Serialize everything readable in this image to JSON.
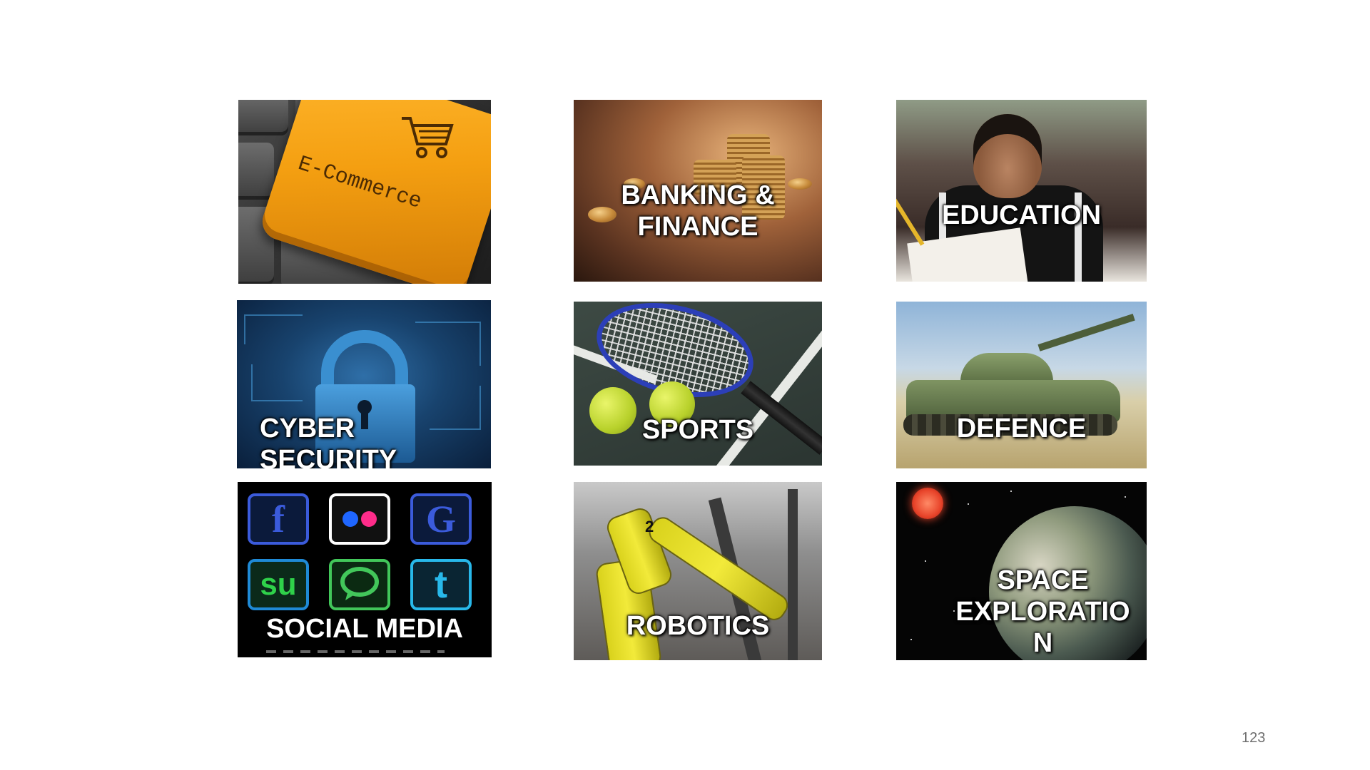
{
  "tiles": {
    "ecommerce": {
      "key_text": "E-Commerce"
    },
    "banking": {
      "label": "BANKING &\nFINANCE"
    },
    "education": {
      "label": "EDUCATION"
    },
    "cyber": {
      "label": "CYBER\nSECURITY"
    },
    "sports": {
      "label": "SPORTS"
    },
    "defence": {
      "label": "DEFENCE"
    },
    "social": {
      "label": "SOCIAL MEDIA",
      "icons": [
        {
          "name": "facebook-icon",
          "glyph": "f",
          "color": "#3b5bdb"
        },
        {
          "name": "flickr-icon",
          "glyph": "●●",
          "color": "#ffffff"
        },
        {
          "name": "google-icon",
          "glyph": "G",
          "color": "#3b5bdb"
        },
        {
          "name": "stumbleupon-icon",
          "glyph": "su",
          "color": "#2fd14a"
        },
        {
          "name": "chat-icon",
          "glyph": "💬",
          "color": "#42c75a"
        },
        {
          "name": "twitter-icon",
          "glyph": "t",
          "color": "#28b8ea"
        }
      ]
    },
    "robotics": {
      "label": "ROBOTICS",
      "arm_number": "2"
    },
    "space": {
      "label": "SPACE\nEXPLORATIO\nN"
    }
  },
  "page_number": "123"
}
